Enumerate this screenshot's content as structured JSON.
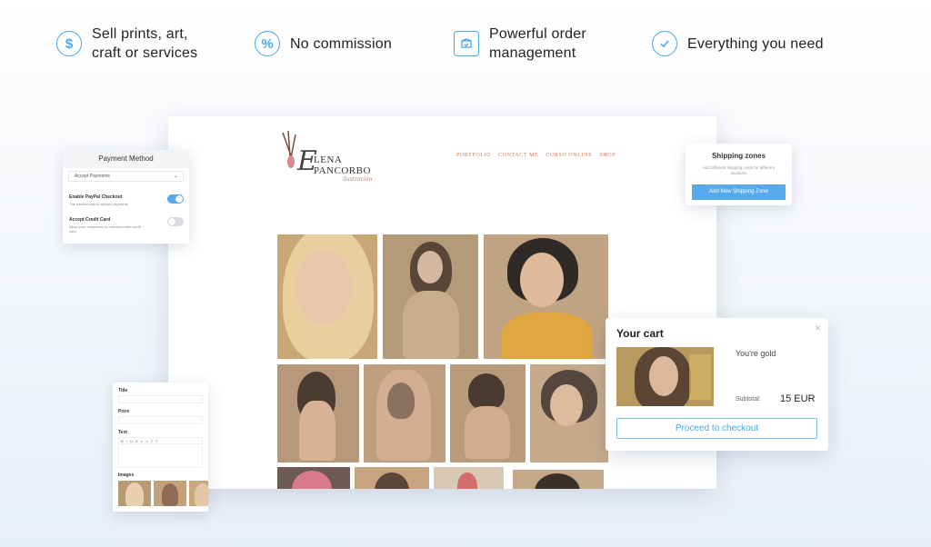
{
  "features": [
    {
      "icon": "dollar-icon",
      "line1": "Sell prints, art,",
      "line2": "craft or services"
    },
    {
      "icon": "percent-icon",
      "line1": "No commission",
      "line2": ""
    },
    {
      "icon": "package-icon",
      "line1": "Powerful order",
      "line2": "management"
    },
    {
      "icon": "check-icon",
      "line1": "Everything you need",
      "line2": ""
    }
  ],
  "site": {
    "logo": {
      "script": "E",
      "line1": "LENA",
      "line2": "PANCORBO",
      "line3": "ilustración"
    },
    "nav": [
      "PORTFOLIO",
      "CONTACT ME",
      "CURSO ONLINE",
      "SHOP"
    ]
  },
  "payment": {
    "title": "Payment Method",
    "select_value": "Accept Payments",
    "paypal_title": "Enable PayPal Checkout",
    "paypal_desc": "The easiest way to accept payments",
    "paypal_enabled": true,
    "card_title": "Accept Credit Card",
    "card_desc": "Allow your customers to checkout with credit card",
    "card_enabled": false
  },
  "shipping": {
    "title": "Shipping zones",
    "desc": "Add different shipping costs for different locations",
    "button": "Add New Shipping Zone"
  },
  "editor": {
    "title_label": "Title",
    "price_label": "Price",
    "text_label": "Text",
    "toolbar": "B I U S   ◐ ◑   ≡ ≡",
    "images_label": "Images"
  },
  "cart": {
    "title": "Your cart",
    "close": "×",
    "product_name": "You're gold",
    "subtotal_label": "Subtotal:",
    "subtotal_value": "15 EUR",
    "checkout_button": "Proceed to checkout"
  },
  "colors": {
    "accent": "#4aa7e8",
    "toggle_on": "#56a9ec",
    "toggle_off": "#d9dce1",
    "nav": "#c9795d"
  }
}
